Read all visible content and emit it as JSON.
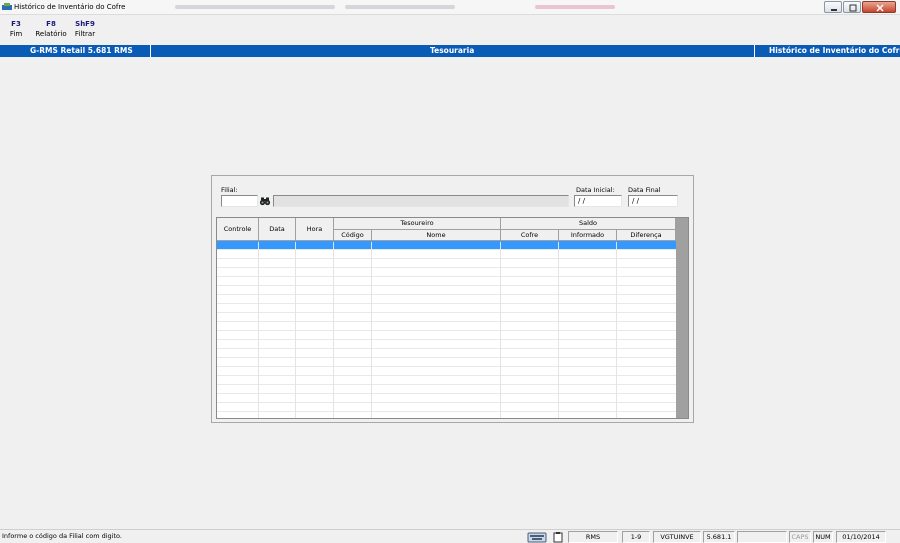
{
  "window": {
    "title": "Histórico de Inventário do Cofre"
  },
  "toolbar": {
    "items": [
      {
        "key": "F3",
        "label": "Fim"
      },
      {
        "key": "F8",
        "label": "Relatório"
      },
      {
        "key": "ShF9",
        "label": "Filtrar"
      }
    ]
  },
  "header_bar": {
    "left": "G-RMS Retail 5.681 RMS",
    "center": "Tesouraria",
    "right": "Histórico de Inventário do Cofre"
  },
  "form": {
    "filial_label": "Filial:",
    "filial_value": "",
    "filial_name": "",
    "data_inicial_label": "Data Inicial:",
    "data_inicial_value": "/ /",
    "data_final_label": "Data Final",
    "data_final_value": "/ /"
  },
  "grid": {
    "columns": {
      "controle": "Controle",
      "data": "Data",
      "hora": "Hora",
      "tesoureiro_group": "Tesoureiro",
      "codigo": "Código",
      "nome": "Nome",
      "saldo_group": "Saldo",
      "cofre": "Cofre",
      "informado": "Informado",
      "diferenca": "Diferença"
    },
    "rows": []
  },
  "statusbar": {
    "message": "Informe o código da Filial com digito.",
    "cells": {
      "module": "RMS",
      "range": "1-9",
      "program": "VGTUINVE",
      "version": "5.681.1",
      "blank": "",
      "caps": "CAPS",
      "num": "NUM",
      "date": "01/10/2014"
    }
  },
  "colors": {
    "header_bar": "#0a5bb5",
    "selected_row": "#3399ff",
    "scrollbar": "#a0a0a0"
  },
  "icons": [
    "app-icon",
    "minimize-icon",
    "restore-icon",
    "close-icon",
    "binoculars-icon",
    "keyboard-icon",
    "clipboard-icon"
  ]
}
